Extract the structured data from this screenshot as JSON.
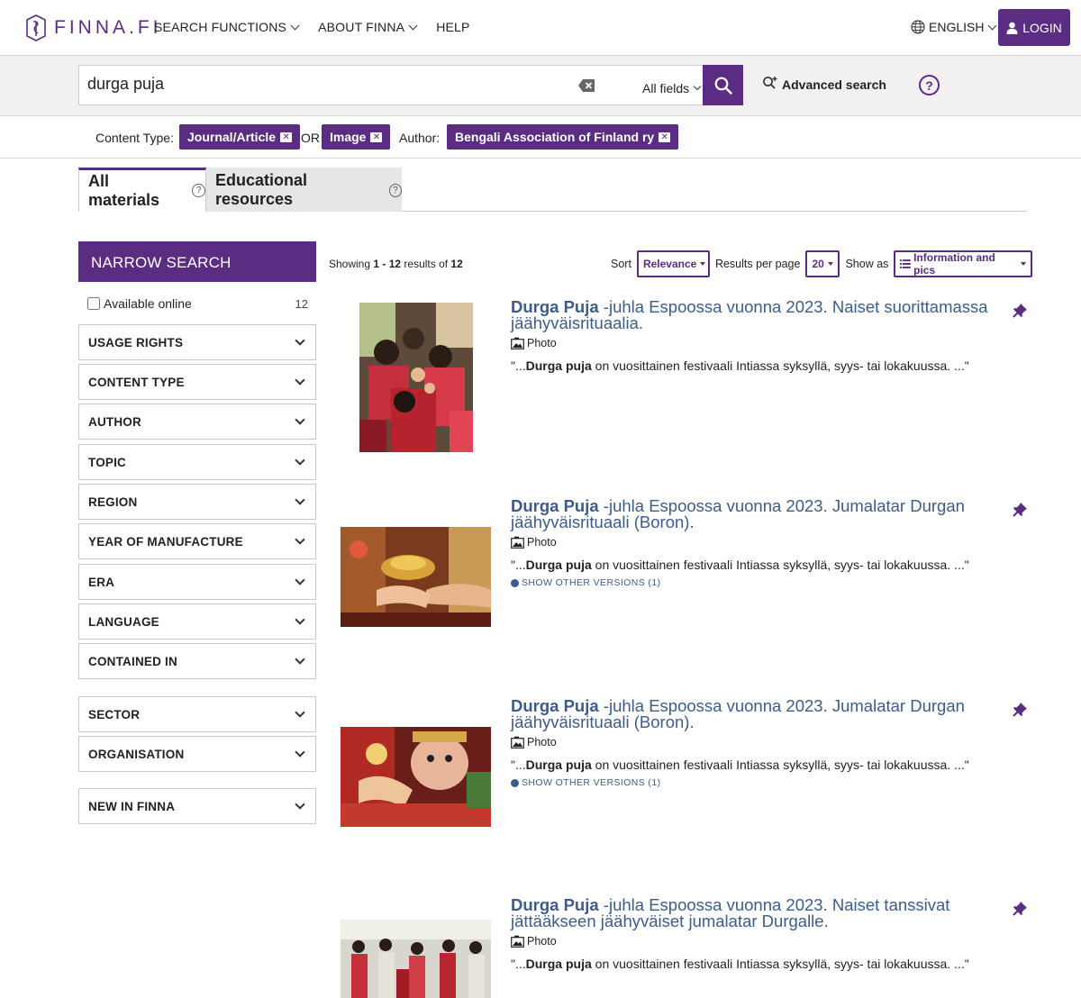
{
  "header": {
    "logo_text": "FINNA.FI",
    "nav": [
      "SEARCH FUNCTIONS",
      "ABOUT FINNA",
      "HELP"
    ],
    "language": "ENGLISH",
    "login": "LOGIN"
  },
  "search": {
    "query": "durga puja",
    "field": "All fields",
    "advanced": "Advanced search",
    "help": "?"
  },
  "filters": {
    "content_type_label": "Content Type:",
    "chip1": "Journal/Article",
    "or": "OR",
    "chip2": "Image",
    "author_label": "Author:",
    "chip3": "Bengali Association of Finland ry"
  },
  "tabs": {
    "all": "All materials",
    "edu": "Educational resources"
  },
  "sidebar": {
    "title": "NARROW SEARCH",
    "available_online": "Available online",
    "available_count": "12",
    "facets": [
      "USAGE RIGHTS",
      "CONTENT TYPE",
      "AUTHOR",
      "TOPIC",
      "REGION",
      "YEAR OF MANUFACTURE",
      "ERA",
      "LANGUAGE",
      "CONTAINED IN",
      "SECTOR",
      "ORGANISATION",
      "NEW IN FINNA"
    ]
  },
  "toolbar": {
    "showing_pre": "Showing ",
    "range": "1 - 12",
    "results_of": " results of ",
    "total": "12",
    "sort_label": "Sort",
    "sort_value": "Relevance",
    "per_page_label": "Results per page",
    "per_page_value": "20",
    "show_as_label": "Show as",
    "show_as_value": "Information and pics"
  },
  "results": [
    {
      "title_bold": "Durga Puja",
      "title_rest": " -juhla Espoossa vuonna 2023. Naiset suorittamassa jäähyväisrituaalia.",
      "type": "Photo",
      "snip_pre": "\"...",
      "snip_bold1": "Durga",
      "snip_bold2": "puja",
      "snip_post": " on vuosittainen festivaali Intiassa syksyllä, syys- tai lokakuussa. ...\"",
      "versions": ""
    },
    {
      "title_bold": "Durga Puja",
      "title_rest": " -juhla Espoossa vuonna 2023. Jumalatar Durgan jäähyväisrituaali (Boron).",
      "type": "Photo",
      "snip_pre": "\"...",
      "snip_bold1": "Durga",
      "snip_bold2": "puja",
      "snip_post": " on vuosittainen festivaali Intiassa syksyllä, syys- tai lokakuussa. ...\"",
      "versions": "SHOW OTHER VERSIONS (1)"
    },
    {
      "title_bold": "Durga Puja",
      "title_rest": " -juhla Espoossa vuonna 2023. Jumalatar Durgan jäähyväisrituaali (Boron).",
      "type": "Photo",
      "snip_pre": "\"...",
      "snip_bold1": "Durga",
      "snip_bold2": "puja",
      "snip_post": " on vuosittainen festivaali Intiassa syksyllä, syys- tai lokakuussa. ...\"",
      "versions": "SHOW OTHER VERSIONS (1)"
    },
    {
      "title_bold": "Durga Puja",
      "title_rest": " -juhla Espoossa vuonna 2023. Naiset tanssivat jättääkseen jäähyväiset jumalatar Durgalle.",
      "type": "Photo",
      "snip_pre": "\"...",
      "snip_bold1": "Durga",
      "snip_bold2": "puja",
      "snip_post": " on vuosittainen festivaali Intiassa syksyllä, syys- tai lokakuussa. ...\"",
      "versions": ""
    }
  ],
  "colors": {
    "brand": "#5a2d82",
    "link": "#3d5c8a"
  }
}
